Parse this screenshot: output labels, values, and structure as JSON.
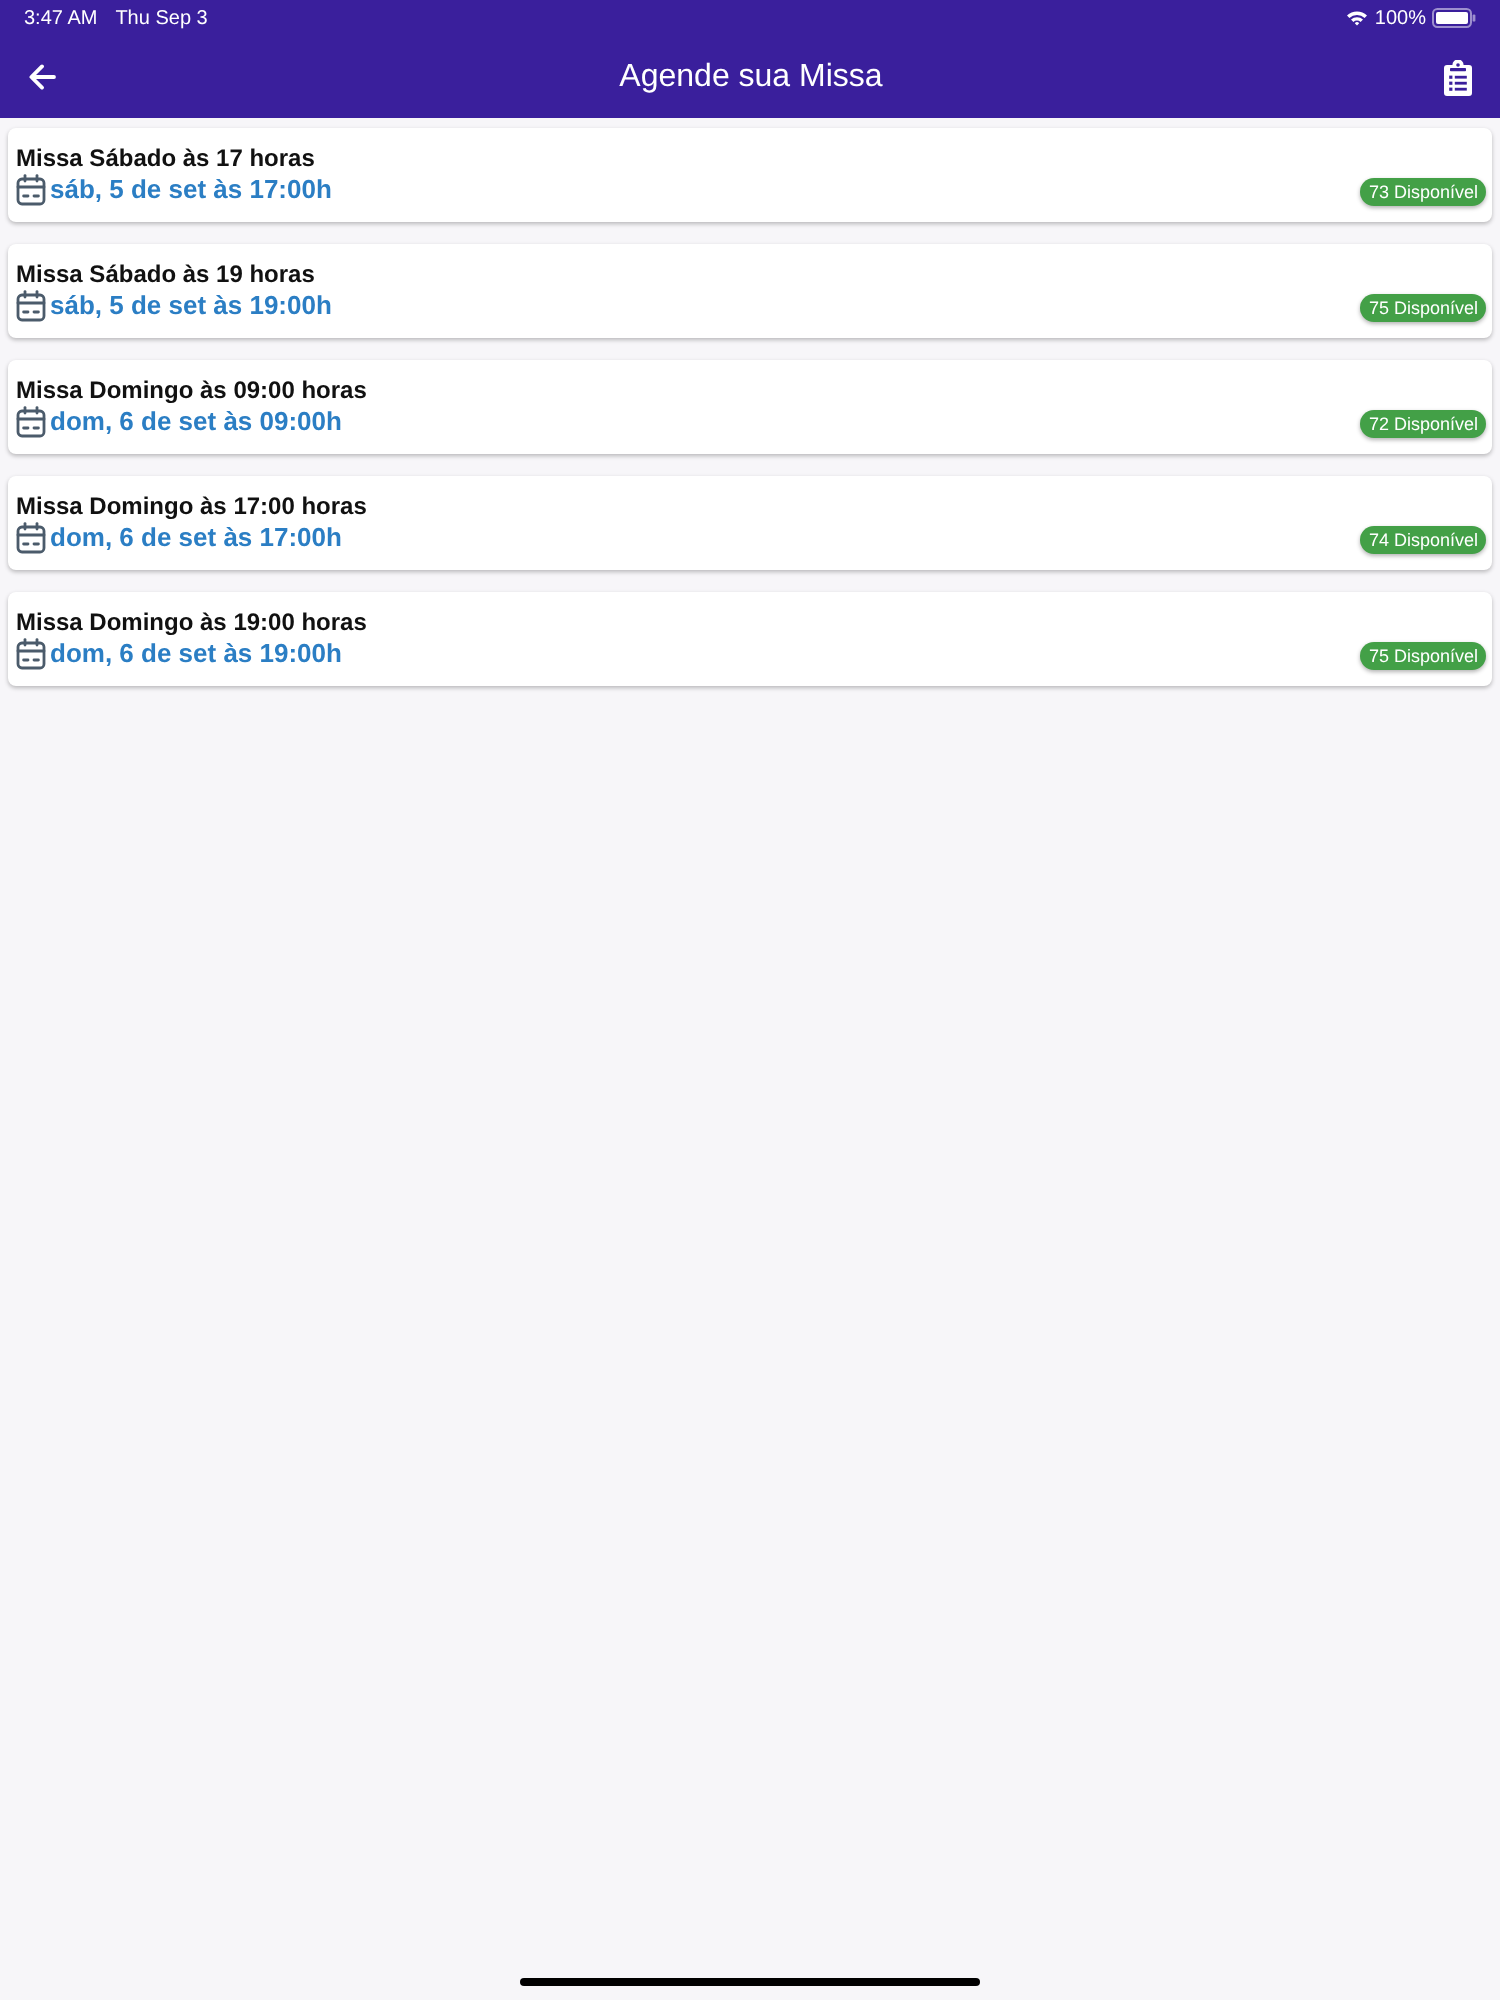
{
  "status_bar": {
    "time": "3:47 AM",
    "date": "Thu Sep 3",
    "battery": "100%"
  },
  "header": {
    "title": "Agende sua Missa"
  },
  "masses": [
    {
      "title": "Missa Sábado às 17 horas",
      "datetime": "sáb, 5 de set às 17:00h",
      "availability": "73 Disponível"
    },
    {
      "title": "Missa Sábado às 19 horas",
      "datetime": "sáb, 5 de set às 19:00h",
      "availability": "75 Disponível"
    },
    {
      "title": "Missa Domingo às 09:00 horas",
      "datetime": "dom, 6 de set às 09:00h",
      "availability": "72 Disponível"
    },
    {
      "title": "Missa Domingo às 17:00 horas",
      "datetime": "dom, 6 de set às 17:00h",
      "availability": "74 Disponível"
    },
    {
      "title": "Missa Domingo às 19:00 horas",
      "datetime": "dom, 6 de set às 19:00h",
      "availability": "75 Disponível"
    }
  ]
}
